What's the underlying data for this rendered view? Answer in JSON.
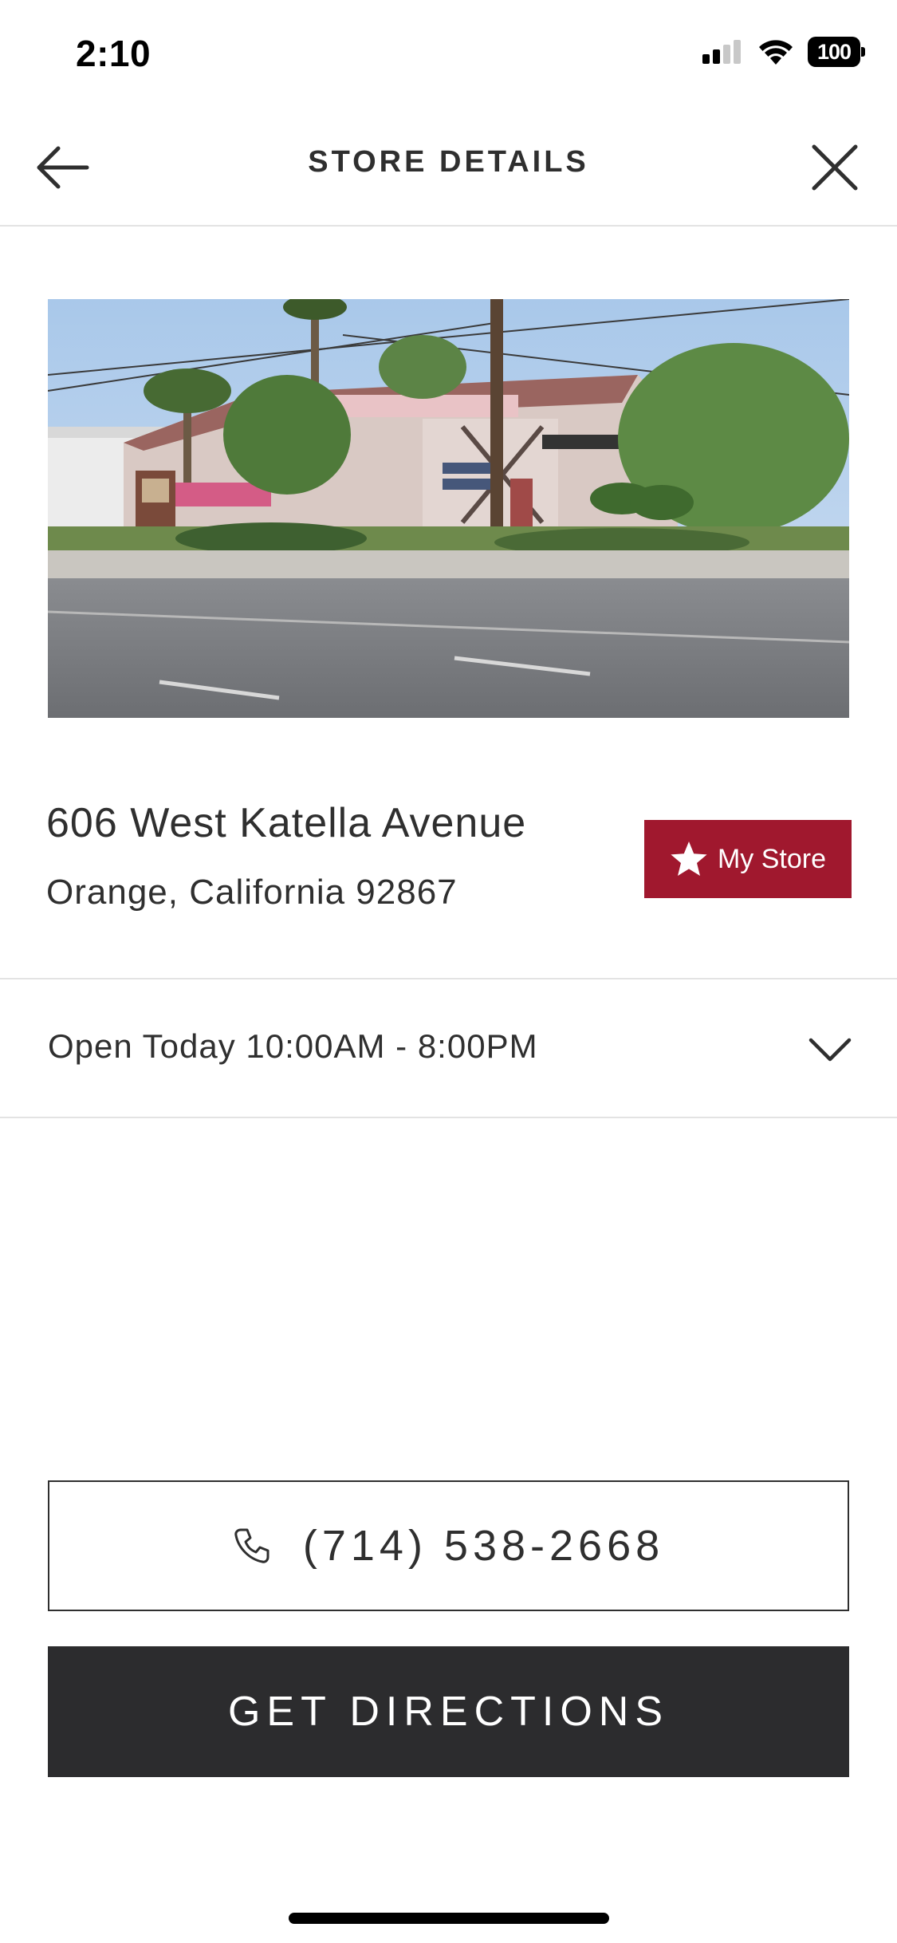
{
  "status_bar": {
    "time": "2:10",
    "battery": "100"
  },
  "header": {
    "title": "STORE DETAILS",
    "back_icon": "arrow-left-icon",
    "close_icon": "close-icon"
  },
  "store": {
    "address_line1": "606 West Katella Avenue",
    "address_line2": "Orange, California 92867",
    "my_store_label": "My Store",
    "hours_text": "Open Today 10:00AM - 8:00PM",
    "phone": "(714) 538-2668",
    "directions_label": "GET DIRECTIONS"
  },
  "colors": {
    "brand_red": "#a0182e",
    "dark_button": "#2c2c2e",
    "text": "#2f2f2f",
    "divider": "#e3e3e3"
  }
}
